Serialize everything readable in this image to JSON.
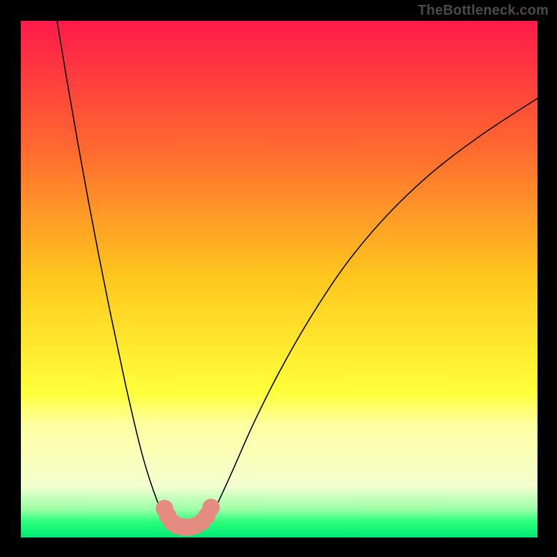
{
  "watermark": "TheBottleneck.com",
  "chart_data": {
    "type": "line",
    "title": "",
    "xlabel": "",
    "ylabel": "",
    "xlim": [
      0,
      100
    ],
    "ylim": [
      0,
      100
    ],
    "grid": false,
    "legend": false,
    "background_gradient": {
      "stops": [
        {
          "offset": 0.0,
          "color": "#ff1a4b"
        },
        {
          "offset": 0.25,
          "color": "#ff6a2f"
        },
        {
          "offset": 0.5,
          "color": "#ffc81e"
        },
        {
          "offset": 0.72,
          "color": "#ffff3a"
        },
        {
          "offset": 0.78,
          "color": "#ffffa0"
        },
        {
          "offset": 0.9,
          "color": "#f3ffd0"
        },
        {
          "offset": 0.945,
          "color": "#9cffa8"
        },
        {
          "offset": 0.97,
          "color": "#2aff7a"
        },
        {
          "offset": 1.0,
          "color": "#00e874"
        }
      ]
    },
    "series": [
      {
        "name": "left-arm",
        "color": "#000000",
        "width": 1.6,
        "x": [
          7.0,
          9.0,
          11.0,
          13.0,
          15.0,
          17.0,
          19.0,
          20.5,
          22.0,
          23.5,
          25.0,
          26.3,
          27.4,
          28.2,
          29.0
        ],
        "y": [
          100.0,
          88.0,
          76.5,
          65.5,
          55.0,
          45.0,
          35.5,
          28.5,
          22.0,
          16.0,
          11.0,
          7.3,
          4.7,
          3.2,
          2.6
        ]
      },
      {
        "name": "valley-floor",
        "color": "#000000",
        "width": 1.6,
        "x": [
          29.0,
          29.8,
          30.8,
          31.8,
          33.0,
          34.2,
          35.3,
          36.0
        ],
        "y": [
          2.6,
          2.3,
          2.1,
          2.0,
          2.1,
          2.3,
          2.7,
          3.2
        ]
      },
      {
        "name": "right-arm",
        "color": "#000000",
        "width": 1.6,
        "x": [
          36.0,
          38.0,
          41.0,
          45.0,
          50.0,
          56.0,
          63.0,
          71.0,
          80.0,
          90.0,
          100.0
        ],
        "y": [
          3.2,
          6.5,
          13.0,
          22.0,
          32.0,
          42.5,
          53.0,
          62.5,
          71.0,
          78.5,
          85.0
        ]
      }
    ],
    "markers": {
      "name": "valley-dots",
      "color": "#e58b82",
      "radius": 1.7,
      "points": [
        {
          "x": 27.8,
          "y": 5.6
        },
        {
          "x": 28.4,
          "y": 4.2
        },
        {
          "x": 29.2,
          "y": 3.0
        },
        {
          "x": 30.2,
          "y": 2.3
        },
        {
          "x": 31.4,
          "y": 2.0
        },
        {
          "x": 32.6,
          "y": 2.0
        },
        {
          "x": 33.8,
          "y": 2.3
        },
        {
          "x": 35.0,
          "y": 3.0
        },
        {
          "x": 36.0,
          "y": 4.2
        },
        {
          "x": 36.8,
          "y": 5.8
        }
      ]
    }
  }
}
